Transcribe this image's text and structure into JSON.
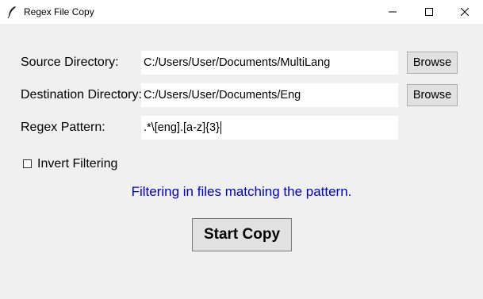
{
  "window": {
    "title": "Regex File Copy",
    "controls": [
      "minimize-icon",
      "maximize-icon",
      "close-icon"
    ]
  },
  "form": {
    "source": {
      "label": "Source Directory:",
      "value": "C:/Users/User/Documents/MultiLang",
      "browse_label": "Browse"
    },
    "destination": {
      "label": "Destination Directory:",
      "value": "C:/Users/User/Documents/Eng",
      "browse_label": "Browse"
    },
    "pattern": {
      "label": "Regex Pattern:",
      "value": ".*\\[eng].[a-z]{3}"
    },
    "invert": {
      "label": "Invert Filtering",
      "checked": false
    }
  },
  "status": {
    "text": "Filtering in files matching the pattern.",
    "color": "#0000cc"
  },
  "actions": {
    "start_label": "Start Copy"
  }
}
